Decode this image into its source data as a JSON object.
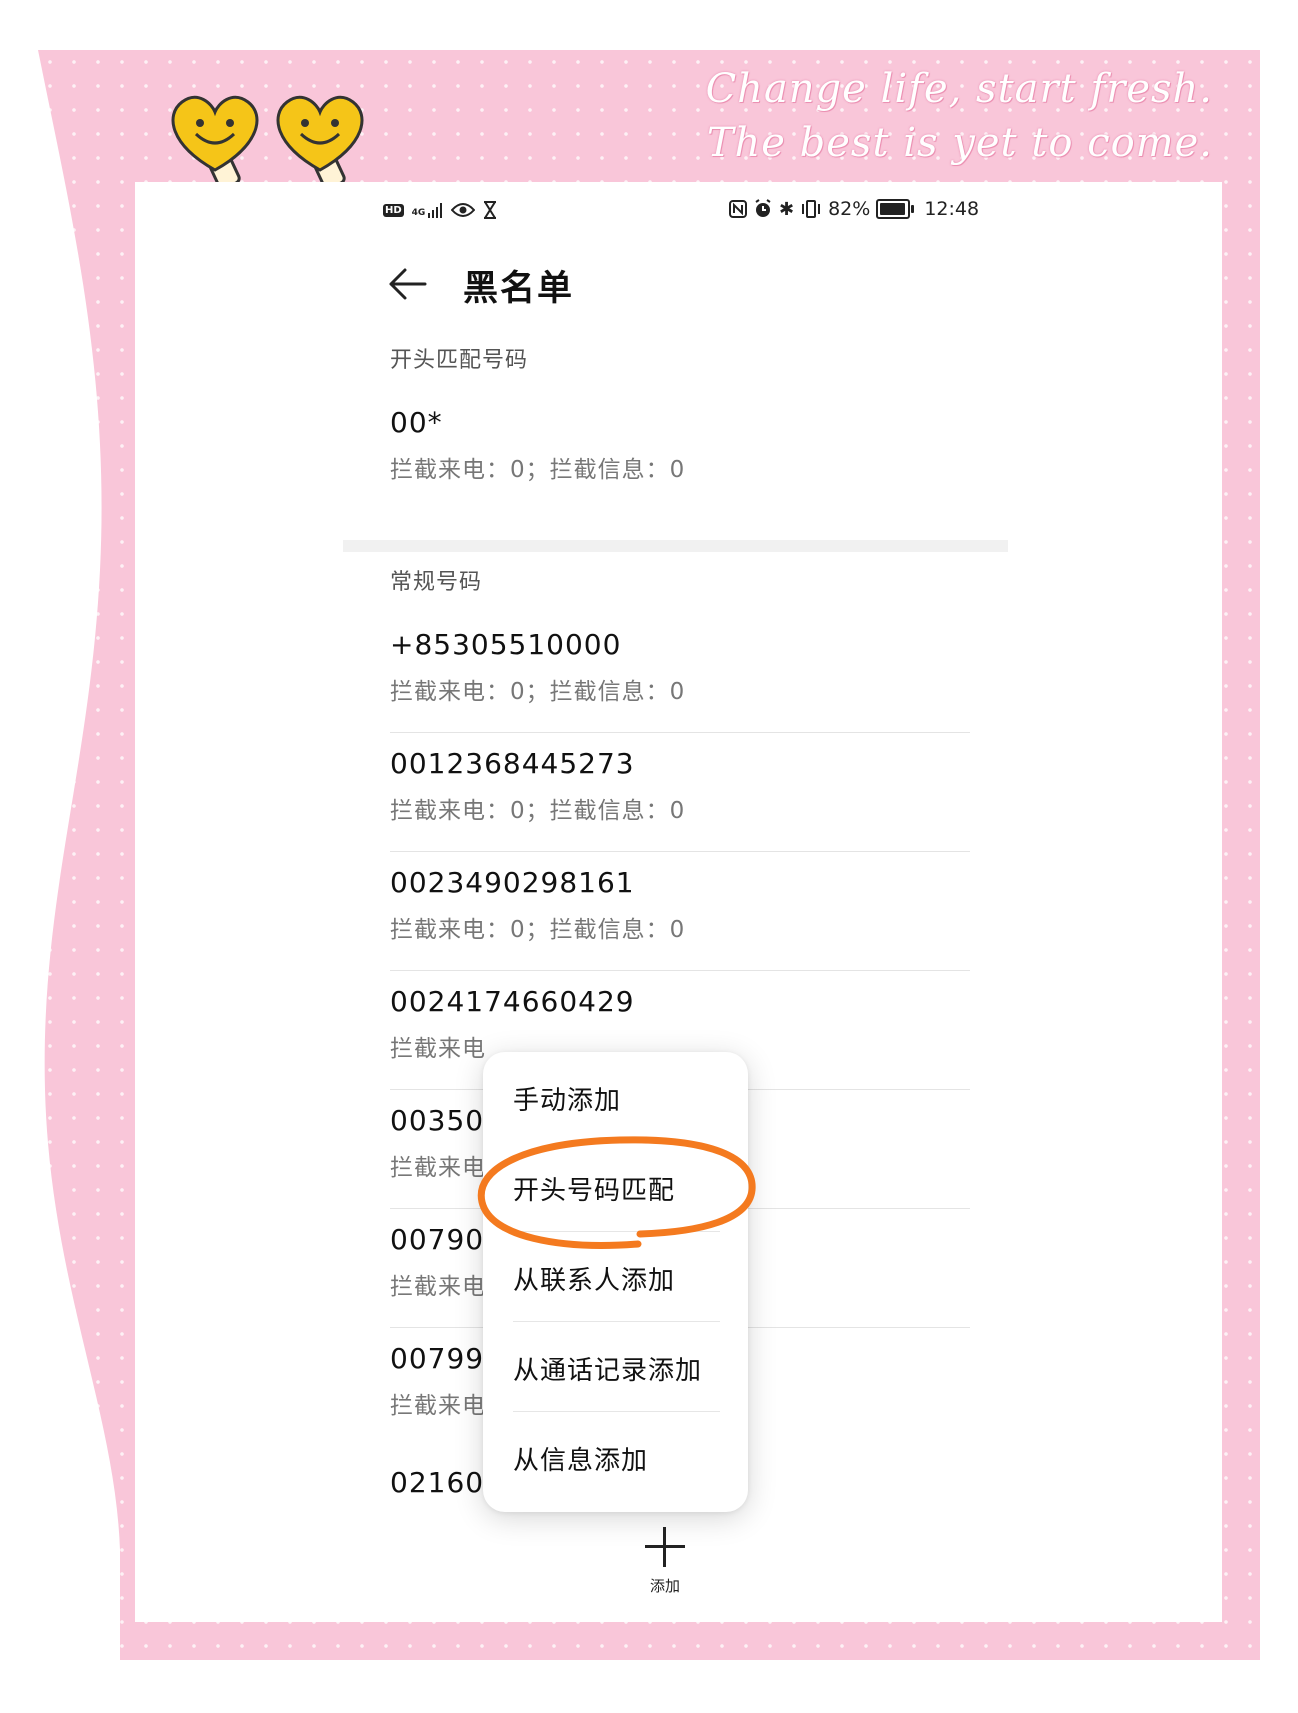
{
  "decoration": {
    "quote_line1": "Change life, start fresh.",
    "quote_line2": "The best is yet to come.",
    "frame_color": "#f9c6d9",
    "heart_color": "#f5c518"
  },
  "status_bar": {
    "left_badge": "HD",
    "network": "4G",
    "battery": "82%",
    "battery_level": 0.82,
    "time": "12:48"
  },
  "header": {
    "title": "黑名单"
  },
  "sections": {
    "prefix_label": "开头匹配号码",
    "regular_label": "常规号码"
  },
  "prefix_entries": [
    {
      "number": "00*",
      "stats": "拦截来电：0；拦截信息：0"
    }
  ],
  "entries": [
    {
      "number": "+85305510000",
      "stats": "拦截来电：0；拦截信息：0"
    },
    {
      "number": "0012368445273",
      "stats": "拦截来电：0；拦截信息：0"
    },
    {
      "number": "0023490298161",
      "stats": "拦截来电：0；拦截信息：0"
    },
    {
      "number": "0024174660429",
      "stats": "拦截来电"
    },
    {
      "number": "003505",
      "stats": "拦截来电"
    },
    {
      "number": "007904",
      "stats": "拦截来电"
    },
    {
      "number": "007999",
      "stats": "拦截来电"
    },
    {
      "number": "0216042?3b1",
      "stats": ""
    }
  ],
  "popup_menu": {
    "items": [
      "手动添加",
      "开头号码匹配",
      "从联系人添加",
      "从通话记录添加",
      "从信息添加"
    ],
    "highlighted": "开头号码匹配",
    "highlight_color": "#f47a1f"
  },
  "fab": {
    "label": "添加"
  }
}
